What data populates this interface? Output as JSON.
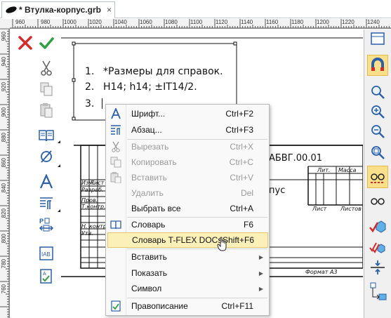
{
  "tab": {
    "title": "* Втулка-корпус.grb",
    "close": "×"
  },
  "ruler": {
    "top_labels": [
      "960",
      "980",
      "1000",
      "1020",
      "1040",
      "1060",
      "1080",
      "1100",
      "1120",
      "1140",
      "1160",
      "1180",
      "1200",
      "1220",
      "1240"
    ],
    "left_labels": [
      "960",
      "940",
      "920",
      "900",
      "880",
      "860",
      "840",
      "820",
      "800",
      "780",
      "760"
    ]
  },
  "drawing": {
    "notes": [
      {
        "num": "1.",
        "text": "*Размеры для справок."
      },
      {
        "num": "2.",
        "text": "H14; h14; ±IT14/2."
      },
      {
        "num": "3.",
        "text": ""
      }
    ],
    "title_block": {
      "designation": "АБВГ.00.01",
      "name": "пус",
      "lit": "Лит.",
      "mass": "Масса",
      "sheet": "Лист",
      "sheets": "Листов",
      "format": "Формат  А3",
      "rows": [
        "Изм.",
        "Лист",
        "Разраб.",
        "Пров.",
        "Т.контр.",
        "Н. контр.",
        "Утв."
      ]
    }
  },
  "context_menu": {
    "items": [
      {
        "icon": "font-icon",
        "label": "Шрифт...",
        "shortcut": "Ctrl+F2",
        "disabled": false
      },
      {
        "icon": "paragraph-icon",
        "label": "Абзац...",
        "shortcut": "Ctrl+F3",
        "disabled": false
      },
      {
        "icon": "cut-icon",
        "label": "Вырезать",
        "shortcut": "Ctrl+X",
        "disabled": true
      },
      {
        "icon": "copy-icon",
        "label": "Копировать",
        "shortcut": "Ctrl+C",
        "disabled": true
      },
      {
        "icon": "paste-icon",
        "label": "Вставить",
        "shortcut": "Ctrl+V",
        "disabled": true
      },
      {
        "icon": "",
        "label": "Удалить",
        "shortcut": "Del",
        "disabled": true
      },
      {
        "icon": "",
        "label": "Выбрать все",
        "shortcut": "Ctrl+A",
        "disabled": false
      },
      {
        "icon": "dictionary-icon",
        "label": "Словарь",
        "shortcut": "F6",
        "disabled": false
      },
      {
        "icon": "",
        "label": "Словарь T-FLEX DOCs",
        "shortcut": "Shift+F6",
        "disabled": false,
        "highlighted": true
      },
      {
        "icon": "",
        "label": "Вставить",
        "shortcut": "",
        "submenu": true
      },
      {
        "icon": "",
        "label": "Показать",
        "shortcut": "",
        "submenu": true
      },
      {
        "icon": "",
        "label": "Символ",
        "shortcut": "",
        "submenu": true
      },
      {
        "icon": "spellcheck-icon",
        "label": "Правописание",
        "shortcut": "Ctrl+F11",
        "disabled": false
      }
    ]
  },
  "colors": {
    "accent_red": "#d42b2b",
    "accent_green": "#2ea043",
    "icon_blue": "#2b5fa8",
    "highlight": "#fbf0b8"
  }
}
